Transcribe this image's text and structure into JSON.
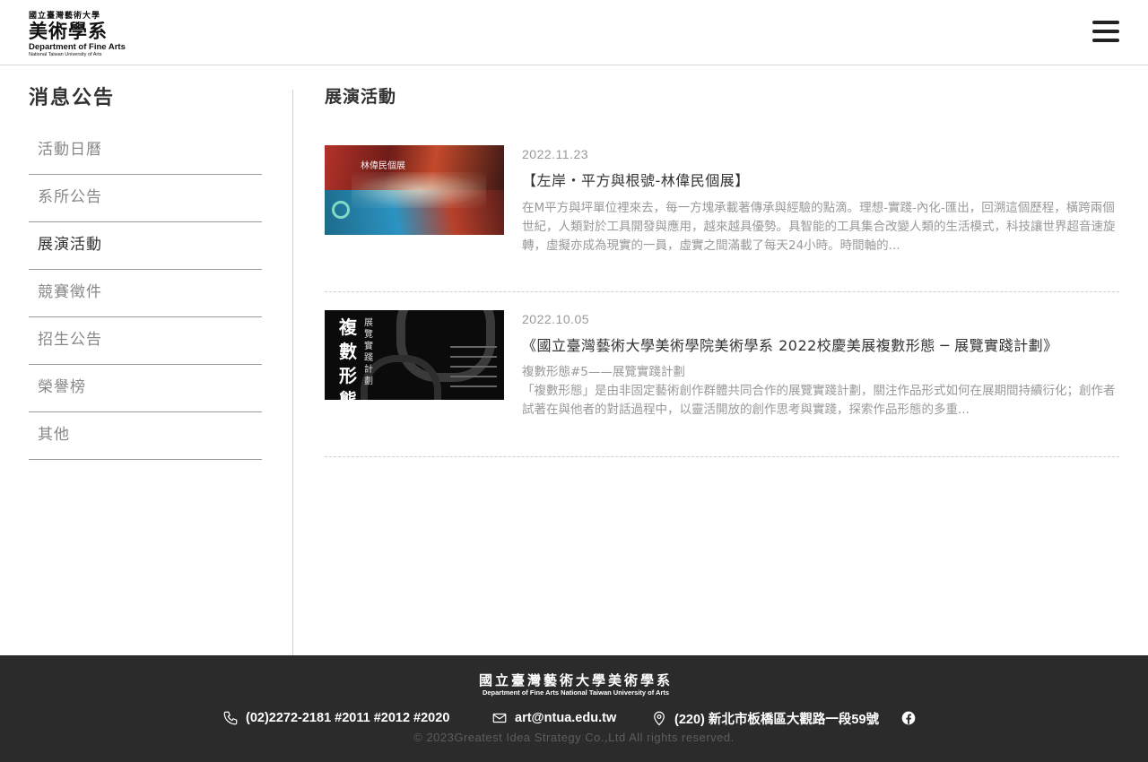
{
  "header": {
    "logo": {
      "line1": "國立臺灣藝術大學",
      "line2": "美術學系",
      "line3": "Department of Fine Arts",
      "line4": "National Taiwan University of  Arts"
    },
    "menu_icon": "hamburger-icon"
  },
  "sidebar": {
    "title": "消息公告",
    "items": [
      {
        "label": "活動日曆",
        "active": false
      },
      {
        "label": "系所公告",
        "active": false
      },
      {
        "label": "展演活動",
        "active": true
      },
      {
        "label": "競賽徵件",
        "active": false
      },
      {
        "label": "招生公告",
        "active": false
      },
      {
        "label": "榮譽榜",
        "active": false
      },
      {
        "label": "其他",
        "active": false
      }
    ]
  },
  "main": {
    "title": "展演活動",
    "posts": [
      {
        "date": "2022.11.23",
        "title": "【左岸・平方與根號-林偉民個展】",
        "thumb_text": "林偉民個展",
        "excerpt": "在M平方與坪單位裡來去，每一方塊承載著傳承與經驗的點滴。理想-實踐-內化-匯出，回溯這個歷程，橫跨兩個世紀，人類對於工具開發與應用，越來越具優勢。具智能的工具集合改變人類的生活模式，科技讓世界超音速旋轉，虛擬亦成為現實的一員，虛實之間滿載了每天24小時。時間軸的..."
      },
      {
        "date": "2022.10.05",
        "title": "《國立臺灣藝術大學美術學院美術學系 2022校慶美展複數形態 ─ 展覽實踐計劃》",
        "thumb_big": "複數形態",
        "thumb_small": "展覽實踐計劃",
        "excerpt_line1": "複數形態#5——展覽實踐計劃",
        "excerpt": "「複數形態」是由非固定藝術創作群體共同合作的展覽實踐計劃，關注作品形式如何在展期間持續衍化；創作者試著在與他者的對話過程中，以靈活開放的創作思考與實踐，探索作品形態的多重..."
      }
    ]
  },
  "footer": {
    "logo_line1": "國立臺灣藝術大學美術學系",
    "logo_line2": "Department of Fine Arts  National Taiwan University of  Arts",
    "phone": "(02)2272-2181 #2011 #2012 #2020",
    "email": "art@ntua.edu.tw",
    "address": "(220) 新北市板橋區大觀路一段59號",
    "social_icon": "facebook-icon",
    "copyright": "© 2023Greatest Idea Strategy Co.,Ltd All rights reserved."
  },
  "colors": {
    "footer_bg": "#2b2b2b",
    "text_dark": "#333333",
    "text_muted": "#999999",
    "divider": "#9a9a9a"
  }
}
